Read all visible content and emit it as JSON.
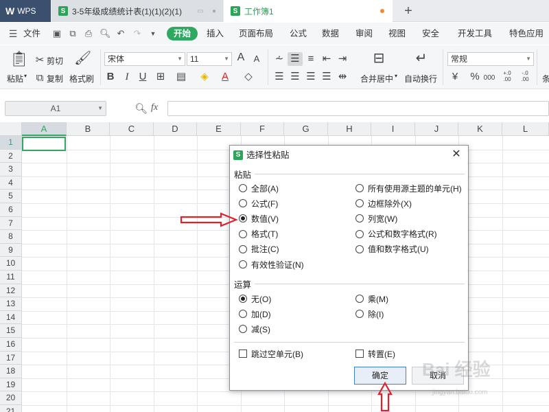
{
  "titlebar": {
    "app_label": "WPS",
    "tab1_label": "3-5年级成绩统计表(1)(1)(2)(1)",
    "tab2_label": "工作簿1",
    "sheet_icon_letter": "S",
    "new_tab": "+"
  },
  "menubar": {
    "file_label": "文件",
    "items": [
      "开始",
      "插入",
      "页面布局",
      "公式",
      "数据",
      "审阅",
      "视图",
      "安全",
      "开发工具",
      "特色应用"
    ],
    "active": "开始"
  },
  "ribbon": {
    "paste": "粘贴",
    "cut": "剪切",
    "copy": "复制",
    "format_painter": "格式刷",
    "font_name": "宋体",
    "font_size": "11",
    "merge_center": "合并居中",
    "wrap_text": "自动换行",
    "number_format": "常规",
    "bold": "B",
    "italic": "I",
    "underline": "U",
    "font_grow": "A",
    "font_shrink": "A",
    "font_color": "A",
    "percent": "%",
    "thousands": "000",
    "dec_add": "+.0\n.00",
    "dec_remove": "-.0\n.00",
    "condition": "条"
  },
  "formula_bar": {
    "name_box": "A1",
    "fx": "fx"
  },
  "grid": {
    "columns": [
      "A",
      "B",
      "C",
      "D",
      "E",
      "F",
      "G",
      "H",
      "I",
      "J",
      "K",
      "L"
    ],
    "rows": [
      "1",
      "2",
      "3",
      "4",
      "5",
      "6",
      "7",
      "8",
      "9",
      "10",
      "11",
      "12",
      "13",
      "14",
      "15",
      "16",
      "17",
      "18",
      "19",
      "20",
      "21"
    ],
    "active_cell": "A1"
  },
  "dialog": {
    "title": "选择性粘贴",
    "paste_group": "粘贴",
    "paste_left": [
      {
        "label": "全部(A)",
        "checked": false
      },
      {
        "label": "公式(F)",
        "checked": false
      },
      {
        "label": "数值(V)",
        "checked": true
      },
      {
        "label": "格式(T)",
        "checked": false
      },
      {
        "label": "批注(C)",
        "checked": false
      },
      {
        "label": "有效性验证(N)",
        "checked": false
      }
    ],
    "paste_right": [
      {
        "label": "所有使用源主题的单元(H)",
        "checked": false
      },
      {
        "label": "边框除外(X)",
        "checked": false
      },
      {
        "label": "列宽(W)",
        "checked": false
      },
      {
        "label": "公式和数字格式(R)",
        "checked": false
      },
      {
        "label": "值和数字格式(U)",
        "checked": false
      }
    ],
    "op_group": "运算",
    "op_left": [
      {
        "label": "无(O)",
        "checked": true
      },
      {
        "label": "加(D)",
        "checked": false
      },
      {
        "label": "减(S)",
        "checked": false
      }
    ],
    "op_right": [
      {
        "label": "乘(M)",
        "checked": false
      },
      {
        "label": "除(I)",
        "checked": false
      }
    ],
    "skip_blanks": "跳过空单元(B)",
    "transpose": "转置(E)",
    "ok": "确定",
    "cancel": "取消"
  },
  "watermark": {
    "text": "Bai 经验",
    "sub": "jingyan.baidu.com"
  },
  "colors": {
    "accent_green": "#2fa862",
    "arrow_red": "#e0202a"
  }
}
